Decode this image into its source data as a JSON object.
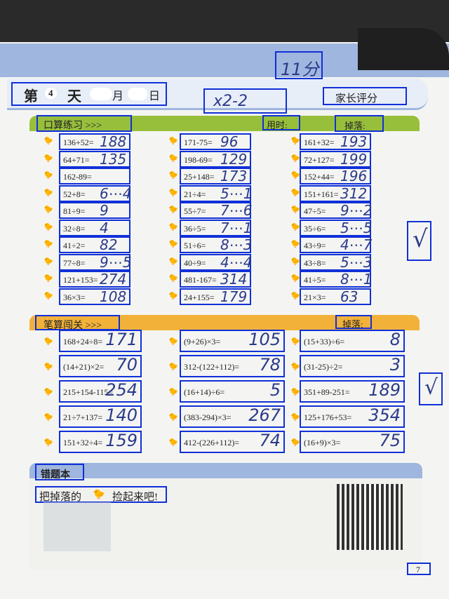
{
  "header": {
    "day_prefix": "第",
    "day_num": "4",
    "day_suffix": "天",
    "month": "月",
    "date": "日",
    "parent_score": "家长评分",
    "hand_time": "11分",
    "hand_score": "x2-2"
  },
  "section1": {
    "title": "口算练习 >>>",
    "time_label": "用时:",
    "drop_label": "掉落:",
    "col1": [
      {
        "eq": "136+52=",
        "ans": "188"
      },
      {
        "eq": "64+71=",
        "ans": "135"
      },
      {
        "eq": "162-89=",
        "ans": ""
      },
      {
        "eq": "52+8=",
        "ans": "6⋯4"
      },
      {
        "eq": "81÷9=",
        "ans": "9"
      },
      {
        "eq": "32÷8=",
        "ans": "4"
      },
      {
        "eq": "41÷2=",
        "ans": "82"
      },
      {
        "eq": "77÷8=",
        "ans": "9⋯5"
      },
      {
        "eq": "121+153=",
        "ans": "274"
      },
      {
        "eq": "36×3=",
        "ans": "108"
      }
    ],
    "col2": [
      {
        "eq": "171-75=",
        "ans": "96"
      },
      {
        "eq": "198-69=",
        "ans": "129"
      },
      {
        "eq": "25+148=",
        "ans": "173"
      },
      {
        "eq": "21÷4=",
        "ans": "5⋯1"
      },
      {
        "eq": "55÷7=",
        "ans": "7⋯6"
      },
      {
        "eq": "36÷5=",
        "ans": "7⋯1"
      },
      {
        "eq": "51÷6=",
        "ans": "8⋯3"
      },
      {
        "eq": "40÷9=",
        "ans": "4⋯4"
      },
      {
        "eq": "481-167=",
        "ans": "314"
      },
      {
        "eq": "24+155=",
        "ans": "179"
      }
    ],
    "col3": [
      {
        "eq": "161+32=",
        "ans": "193"
      },
      {
        "eq": "72+127=",
        "ans": "199"
      },
      {
        "eq": "152+44=",
        "ans": "196"
      },
      {
        "eq": "151+161=",
        "ans": "312"
      },
      {
        "eq": "47÷5=",
        "ans": "9⋯2"
      },
      {
        "eq": "35÷6=",
        "ans": "5⋯5"
      },
      {
        "eq": "43÷9=",
        "ans": "4⋯7"
      },
      {
        "eq": "43÷8=",
        "ans": "5⋯3"
      },
      {
        "eq": "41÷5=",
        "ans": "8⋯1"
      },
      {
        "eq": "21×3=",
        "ans": "63"
      }
    ],
    "mark": "√"
  },
  "section2": {
    "title": "笔算闯关 >>>",
    "drop_label": "掉落:",
    "col1": [
      {
        "eq": "168+24÷8=",
        "ans": "171"
      },
      {
        "eq": "(14+21)×2=",
        "ans": "70"
      },
      {
        "eq": "215+154-115=",
        "ans": "254"
      },
      {
        "eq": "21÷7+137=",
        "ans": "140"
      },
      {
        "eq": "151+32÷4=",
        "ans": "159"
      }
    ],
    "col2": [
      {
        "eq": "(9+26)×3=",
        "ans": "105"
      },
      {
        "eq": "312-(122+112)=",
        "ans": "78"
      },
      {
        "eq": "(16+14)÷6=",
        "ans": "5"
      },
      {
        "eq": "(383-294)×3=",
        "ans": "267"
      },
      {
        "eq": "412-(226+112)=",
        "ans": "74"
      }
    ],
    "col3": [
      {
        "eq": "(15+33)÷6=",
        "ans": "8"
      },
      {
        "eq": "(31-25)÷2=",
        "ans": "3"
      },
      {
        "eq": "351+89-251=",
        "ans": "189"
      },
      {
        "eq": "125+176+53=",
        "ans": "354"
      },
      {
        "eq": "(16+9)×3=",
        "ans": "75"
      }
    ],
    "mark": "√"
  },
  "section3": {
    "title": "错题本",
    "subtitle": "把掉落的",
    "subtitle2": "捡起来吧!"
  },
  "footer": {
    "page": "7"
  }
}
